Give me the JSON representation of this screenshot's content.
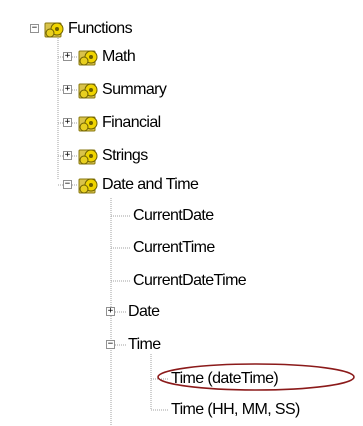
{
  "tree": {
    "root": {
      "label": "Functions",
      "icon": "gear-folder-icon",
      "expanded": true
    },
    "categories": [
      {
        "label": "Math",
        "icon": "gear-folder-icon",
        "expanded": false
      },
      {
        "label": "Summary",
        "icon": "gear-folder-icon",
        "expanded": false
      },
      {
        "label": "Financial",
        "icon": "gear-folder-icon",
        "expanded": false
      },
      {
        "label": "Strings",
        "icon": "gear-folder-icon",
        "expanded": false
      },
      {
        "label": "Date and Time",
        "icon": "gear-folder-icon",
        "expanded": true
      }
    ],
    "date_time_items": [
      {
        "label": "CurrentDate"
      },
      {
        "label": "CurrentTime"
      },
      {
        "label": "CurrentDateTime"
      },
      {
        "label": "Date",
        "expanded": false
      },
      {
        "label": "Time",
        "expanded": true
      }
    ],
    "time_items": [
      {
        "label": "Time (dateTime)",
        "highlighted": true
      },
      {
        "label": "Time (HH, MM, SS)"
      }
    ]
  },
  "colors": {
    "highlight_ring": "#8b1a1a",
    "tree_lines": "#a0a0a0",
    "toggle_border": "#919191",
    "gear_fill": "#b8a000"
  }
}
